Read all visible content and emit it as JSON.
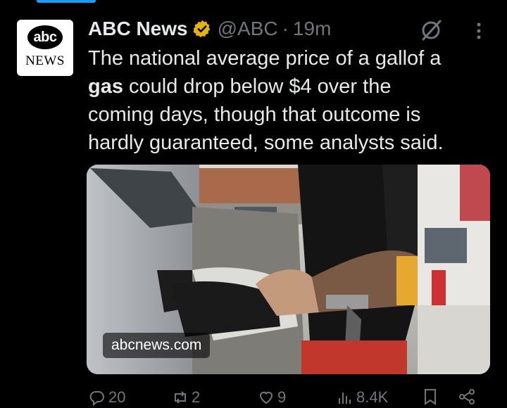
{
  "post": {
    "author_name": "ABC News",
    "handle": "@ABC",
    "separator": "·",
    "time": "19m",
    "avatar": {
      "top": "abc",
      "bottom": "NEWS"
    },
    "text_line1": "The national average price of a gallof a",
    "text_bold": "gas",
    "text_line2_rest": " could drop below $4 over the",
    "text_line3": "coming days, though that outcome is",
    "text_line4": "hardly guaranteed, some analysts said."
  },
  "media": {
    "link_label": "abcnews.com"
  },
  "actions": {
    "replies": "20",
    "reposts": "2",
    "likes": "9",
    "views": "8.4K"
  },
  "colors": {
    "accent": "#1d9bf0",
    "muted": "#71767b",
    "text": "#e7e9ea",
    "verified": "#e8b30b"
  },
  "icons": [
    "grok-icon",
    "more-icon",
    "verified-badge-icon",
    "reply-icon",
    "repost-icon",
    "like-icon",
    "views-icon",
    "bookmark-icon",
    "share-icon"
  ]
}
